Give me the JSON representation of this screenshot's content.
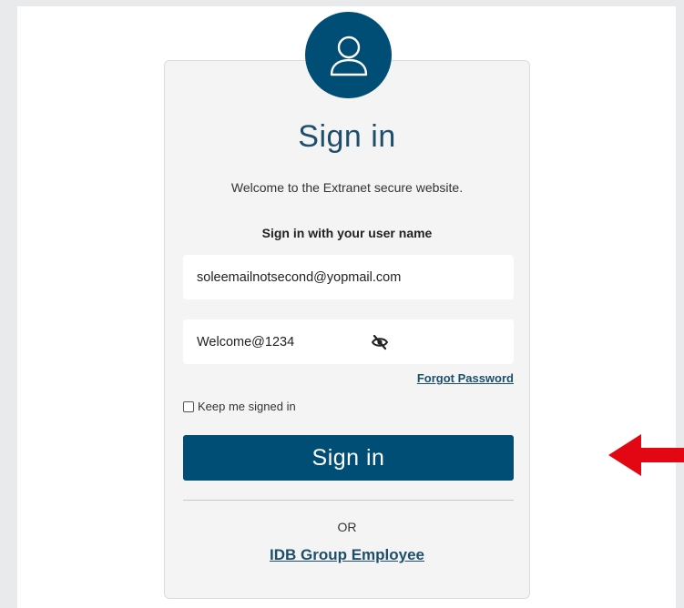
{
  "title": "Sign in",
  "welcome_text": "Welcome to the Extranet secure website.",
  "subheading": "Sign in with your user name",
  "username": {
    "value": "soleemailnotsecond@yopmail.com"
  },
  "password": {
    "value": "Welcome@1234",
    "toggle_icon": "eye-slash-icon"
  },
  "forgot_password_label": "Forgot Password",
  "keep_signed_in_label": "Keep me signed in",
  "keep_signed_in_checked": false,
  "sign_in_button_label": "Sign in",
  "or_label": "OR",
  "employee_link_label": "IDB Group Employee",
  "icons": {
    "avatar": "user-icon",
    "annotation": "arrow-left-icon"
  },
  "colors": {
    "brand": "#004d75",
    "heading": "#1d4f6c",
    "annotation_arrow": "#e30613",
    "card_bg": "#f4f4f4",
    "page_bg": "#e9eaec"
  }
}
